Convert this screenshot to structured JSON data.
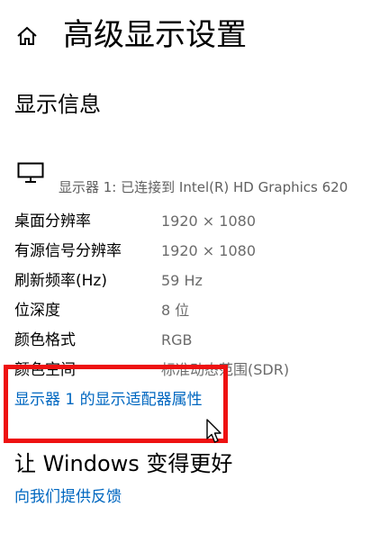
{
  "header": {
    "title": "高级显示设置",
    "home_icon": "home-icon"
  },
  "display_info": {
    "section_title": "显示信息",
    "monitor_icon": "monitor-icon",
    "display_caption": "显示器 1: 已连接到 Intel(R) HD Graphics 620",
    "rows": [
      {
        "label": "桌面分辨率",
        "value": "1920 × 1080"
      },
      {
        "label": "有源信号分辨率",
        "value": "1920 × 1080"
      },
      {
        "label": "刷新频率(Hz)",
        "value": "59 Hz"
      },
      {
        "label": "位深度",
        "value": "8 位"
      },
      {
        "label": "颜色格式",
        "value": "RGB"
      },
      {
        "label": "颜色空间",
        "value": "标准动态范围(SDR)"
      }
    ],
    "adapter_link": "显示器 1 的显示适配器属性"
  },
  "better_windows": {
    "title": "让 Windows 变得更好",
    "feedback_link": "向我们提供反馈"
  },
  "colors": {
    "link": "#0067c0",
    "highlight": "#ee1111",
    "secondary_text": "#6b6b6b"
  }
}
